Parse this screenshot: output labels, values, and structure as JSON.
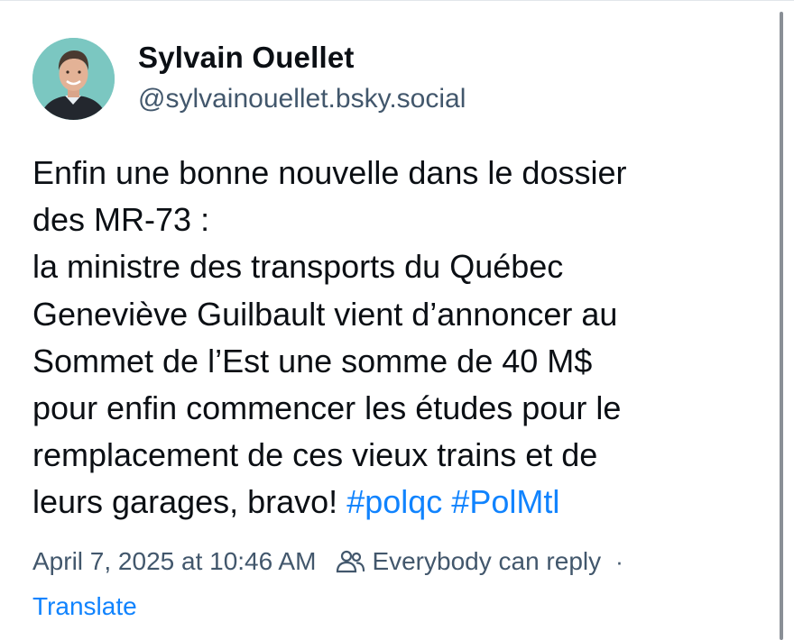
{
  "author": {
    "name": "Sylvain Ouellet",
    "handle": "@sylvainouellet.bsky.social"
  },
  "post": {
    "text": "Enfin une bonne nouvelle dans le dossier\ndes MR-73 :\nla ministre des transports du Québec\nGeneviève Guilbault vient d’annoncer au\nSommet de l’Est une somme de 40 M$\npour enfin commencer les études pour le\nremplacement de ces vieux trains et de\nleurs garages, bravo! ",
    "hashtags": [
      "#polqc",
      "#PolMtl"
    ]
  },
  "meta": {
    "timestamp": "April 7, 2025 at 10:46 AM",
    "reply_setting": "Everybody can reply",
    "separator": "·",
    "reply_icon": "people-icon"
  },
  "actions": {
    "translate_label": "Translate"
  },
  "colors": {
    "text": "#0b0f14",
    "secondary": "#42576c",
    "link": "#1083fe",
    "avatar_bg": "#7bc7c1"
  }
}
